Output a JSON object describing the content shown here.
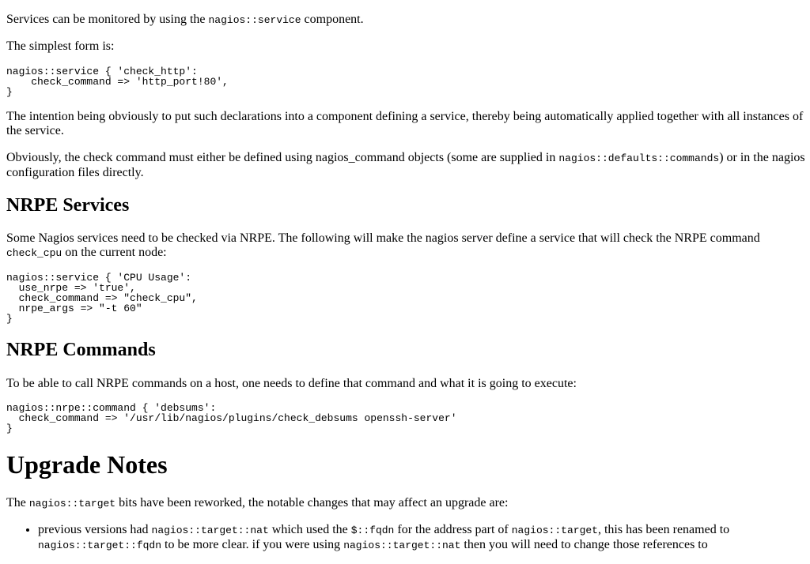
{
  "intro": {
    "p1_a": "Services can be monitored by using the ",
    "p1_code": "nagios::service",
    "p1_b": " component.",
    "p2": "The simplest form is:",
    "code1": "nagios::service { 'check_http':\n    check_command => 'http_port!80',\n}",
    "p3": "The intention being obviously to put such declarations into a component defining a service, thereby being automatically applied together with all instances of the service.",
    "p4_a": "Obviously, the check command must either be defined using nagios_command objects (some are supplied in ",
    "p4_code": "nagios::defaults::commands",
    "p4_b": ") or in the nagios configuration files directly."
  },
  "nrpe_services": {
    "heading": "NRPE Services",
    "p_a": "Some Nagios services need to be checked via NRPE. The following will make the nagios server define a service that will check the NRPE command ",
    "p_code": "check_cpu",
    "p_b": " on the current node:",
    "code": "nagios::service { 'CPU Usage':\n  use_nrpe => 'true',\n  check_command => \"check_cpu\",\n  nrpe_args => \"-t 60\"\n}"
  },
  "nrpe_commands": {
    "heading": "NRPE Commands",
    "p": "To be able to call NRPE commands on a host, one needs to define that command and what it is going to execute:",
    "code": "nagios::nrpe::command { 'debsums':\n  check_command => '/usr/lib/nagios/plugins/check_debsums openssh-server'\n}"
  },
  "upgrade": {
    "heading": "Upgrade Notes",
    "p_a": "The ",
    "p_code": "nagios::target",
    "p_b": " bits have been reworked, the notable changes that may affect an upgrade are:",
    "li_1": "previous versions had ",
    "li_c1": "nagios::target::nat",
    "li_2": " which used the ",
    "li_c2": "$::fqdn",
    "li_3": " for the address part of ",
    "li_c3": "nagios::target",
    "li_4": ", this has been renamed to ",
    "li_c4": "nagios::target::fqdn",
    "li_5": " to be more clear. if you were using ",
    "li_c5": "nagios::target::nat",
    "li_6": " then you will need to change those references to"
  }
}
